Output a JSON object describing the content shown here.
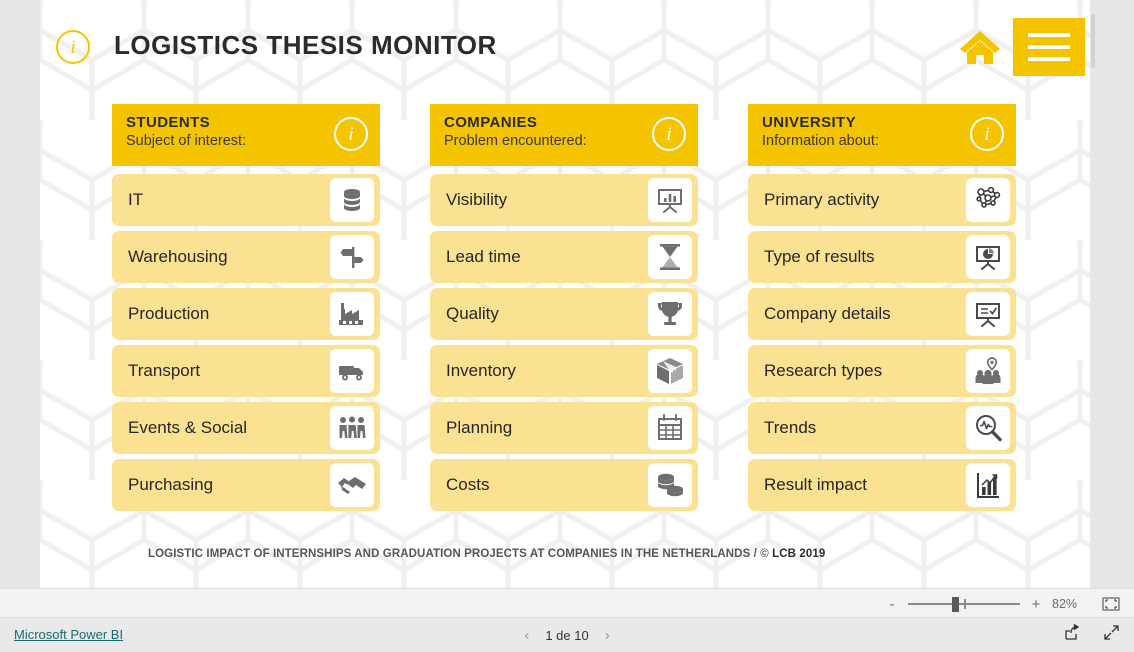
{
  "report": {
    "title": "LOGISTICS THESIS MONITOR",
    "info_glyph": "i",
    "home_icon": "home-icon",
    "menu_icon": "hamburger-menu-icon",
    "footer_credit_main": "LOGISTIC IMPACT OF INTERNSHIPS AND GRADUATION PROJECTS AT COMPANIES IN THE NETHERLANDS / ©",
    "footer_credit_strong": "LCB 2019"
  },
  "columns": [
    {
      "title": "STUDENTS",
      "subtitle": "Subject of interest:",
      "info_glyph": "i",
      "items": [
        {
          "label": "IT",
          "icon": "database-icon"
        },
        {
          "label": "Warehousing",
          "icon": "signpost-icon"
        },
        {
          "label": "Production",
          "icon": "factory-icon"
        },
        {
          "label": "Transport",
          "icon": "truck-icon"
        },
        {
          "label": "Events & Social",
          "icon": "people-group-icon"
        },
        {
          "label": "Purchasing",
          "icon": "handshake-icon"
        }
      ]
    },
    {
      "title": "COMPANIES",
      "subtitle": "Problem encountered:",
      "info_glyph": "i",
      "items": [
        {
          "label": "Visibility",
          "icon": "presentation-chart-icon"
        },
        {
          "label": "Lead time",
          "icon": "hourglass-icon"
        },
        {
          "label": "Quality",
          "icon": "trophy-icon"
        },
        {
          "label": "Inventory",
          "icon": "box-package-icon"
        },
        {
          "label": "Planning",
          "icon": "calendar-icon"
        },
        {
          "label": "Costs",
          "icon": "coins-icon"
        }
      ]
    },
    {
      "title": "UNIVERSITY",
      "subtitle": "Information about:",
      "info_glyph": "i",
      "items": [
        {
          "label": "Primary activity",
          "icon": "molecule-network-icon"
        },
        {
          "label": "Type of results",
          "icon": "presentation-pie-icon"
        },
        {
          "label": "Company details",
          "icon": "presentation-checklist-icon"
        },
        {
          "label": "Research types",
          "icon": "people-location-icon"
        },
        {
          "label": "Trends",
          "icon": "magnifier-pulse-icon"
        },
        {
          "label": "Result impact",
          "icon": "bar-chart-arrow-icon"
        }
      ]
    }
  ],
  "zoom_bar": {
    "minus_label": "-",
    "plus_label": "+",
    "zoom_level": "82%",
    "fit_icon": "fit-to-page-icon"
  },
  "status_bar": {
    "brand_link": "Microsoft Power BI",
    "prev_label": "‹",
    "next_label": "›",
    "page_indicator": "1 de 10",
    "share_icon": "share-icon",
    "fullscreen_icon": "fullscreen-icon"
  },
  "colors": {
    "header_yellow": "#F5C400",
    "item_yellow": "#FBE292",
    "text_dark": "#262626",
    "link_teal": "#1A6B72",
    "canvas_white": "#FFFFFF",
    "chrome_gray": "#E9E9E9"
  }
}
